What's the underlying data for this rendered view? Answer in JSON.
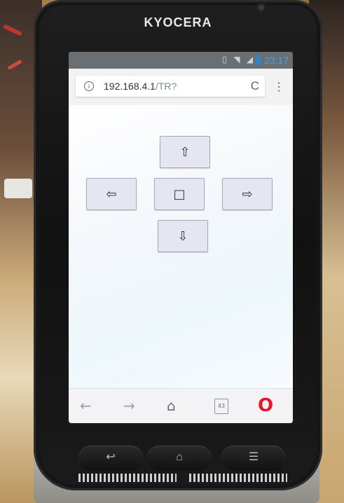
{
  "device": {
    "brand": "KYOCERA"
  },
  "statusbar": {
    "icons": "▯ ◥ ◢",
    "time": "23:17"
  },
  "browser": {
    "url_host": "192.168.4.1",
    "url_path": "/TR?",
    "info_icon": "i",
    "reload_icon": "C",
    "menu_icon": "⋮"
  },
  "controls": {
    "up": "⇧",
    "left": "⇦",
    "stop": "□",
    "right": "⇨",
    "down": "⇩"
  },
  "toolbar": {
    "back": "←",
    "forward": "→",
    "home": "⌂",
    "tabs_count": "43",
    "opera": "O"
  },
  "hardware_keys": {
    "back": "↩",
    "home": "⌂",
    "menu": "☰"
  }
}
